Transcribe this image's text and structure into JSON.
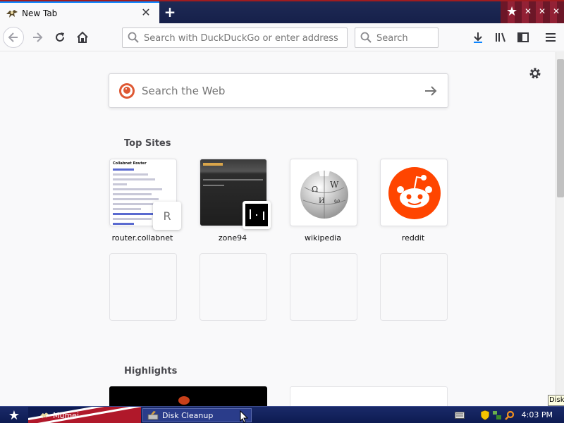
{
  "browser": {
    "tab": {
      "title": "New Tab",
      "close_glyph": "✕"
    },
    "new_tab_glyph": "+",
    "url_placeholder": "Search with DuckDuckGo or enter address",
    "search_placeholder": "Search"
  },
  "newtab": {
    "web_search_placeholder": "Search the Web",
    "top_sites_title": "Top Sites",
    "highlights_title": "Highlights",
    "top_sites": [
      {
        "label": "router.collabnet",
        "badge": "R"
      },
      {
        "label": "zone94",
        "badge": ""
      },
      {
        "label": "wikipedia"
      },
      {
        "label": "reddit"
      }
    ],
    "router_thumb_heading": "Collabnet Router"
  },
  "taskbar": {
    "items": [
      {
        "label": "Mumei"
      },
      {
        "label": "Disk Cleanup"
      }
    ],
    "clock": "4:03 PM",
    "tooltip": "Disk"
  },
  "colors": {
    "accent": "#0a84ff",
    "reddit": "#ff4500",
    "ddg": "#de5833",
    "taskbar": "#0d1b52"
  }
}
